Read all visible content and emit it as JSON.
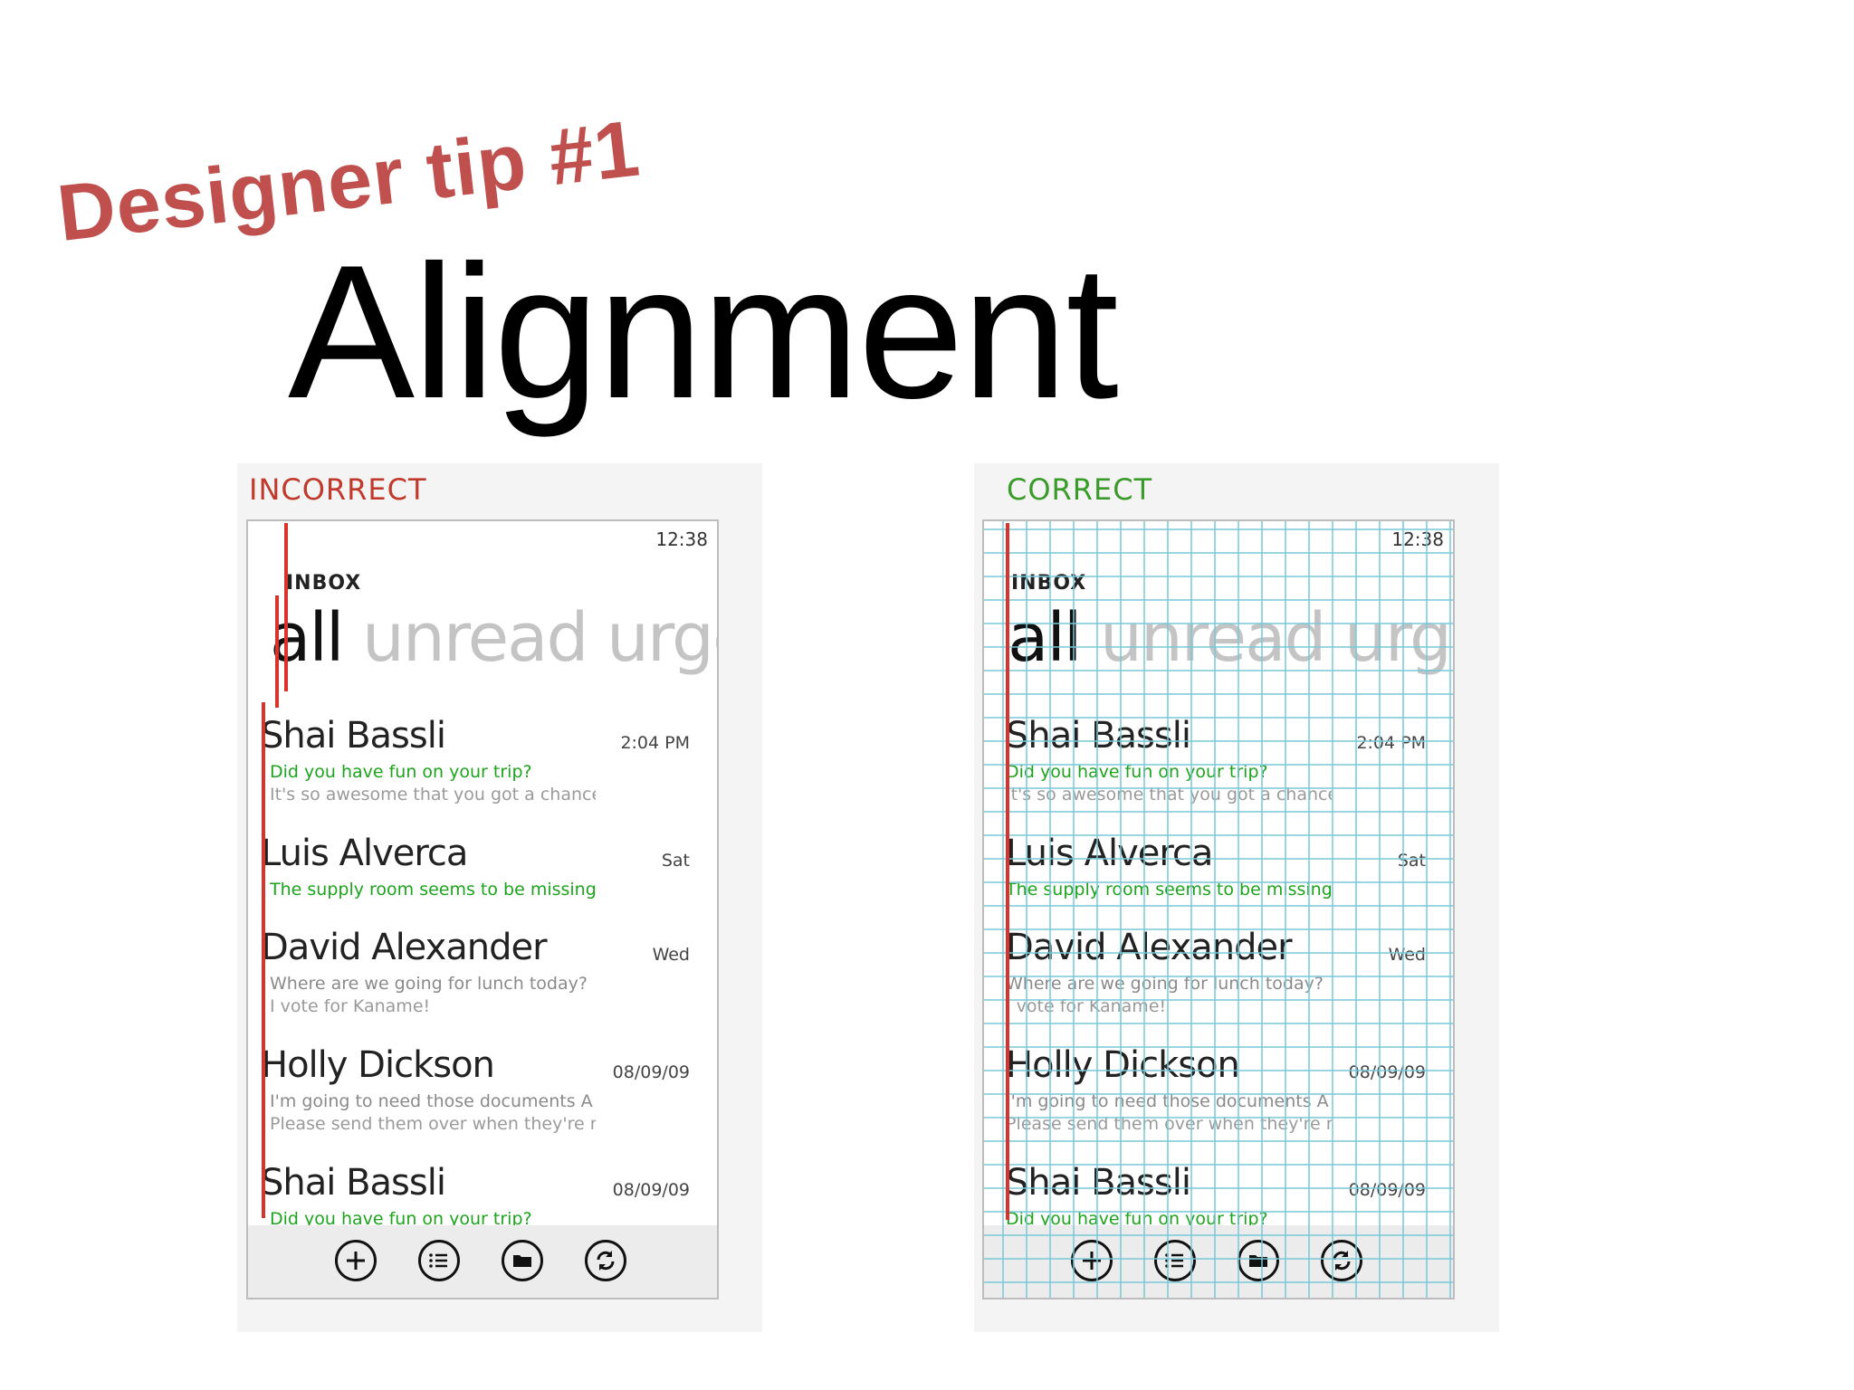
{
  "slide": {
    "tip": "Designer tip #1",
    "headline": "Alignment"
  },
  "colors": {
    "tip_red": "#c0504d",
    "incorrect_red": "#c0392b",
    "correct_green": "#3a9a2a",
    "unread_green": "#1da41d",
    "guide_red": "#d9342b",
    "grid_blue": "#78c8d7"
  },
  "panels": [
    {
      "label": "INCORRECT",
      "label_color": "#c0392b",
      "clock": "12:38",
      "inbox": "INBOX",
      "pivot_active": "all",
      "pivot_inactive": "unread urgen"
    },
    {
      "label": "CORRECT",
      "label_color": "#3a9a2a",
      "clock": "12:38",
      "inbox": "INBOX",
      "pivot_active": "all",
      "pivot_inactive": "unread urgen"
    }
  ],
  "messages": [
    {
      "sender": "Shai Bassli",
      "date": "2:04 PM",
      "subject": "Did you have fun on your trip?",
      "subject_unread": true,
      "preview": "It's so awesome that you got a chance",
      "preview2": ""
    },
    {
      "sender": "Luis Alverca",
      "date": "Sat",
      "subject": "The supply room seems to be missing",
      "subject_unread": true,
      "preview": "",
      "preview2": ""
    },
    {
      "sender": "David Alexander",
      "date": "Wed",
      "subject": "Where are we going for lunch today?",
      "subject_unread": false,
      "preview": "I vote for Kaname!",
      "preview2": ""
    },
    {
      "sender": "Holly Dickson",
      "date": "08/09/09",
      "subject": "I'm going to need those documents A",
      "subject_unread": false,
      "preview": "Please send them over when they're re",
      "preview2": ""
    },
    {
      "sender": "Shai Bassli",
      "date": "08/09/09",
      "subject": "Did you have fun on your trip?",
      "subject_unread": true,
      "preview": "",
      "preview2": ""
    }
  ],
  "appbar": [
    "add-icon",
    "list-icon",
    "folder-icon",
    "sync-icon"
  ]
}
